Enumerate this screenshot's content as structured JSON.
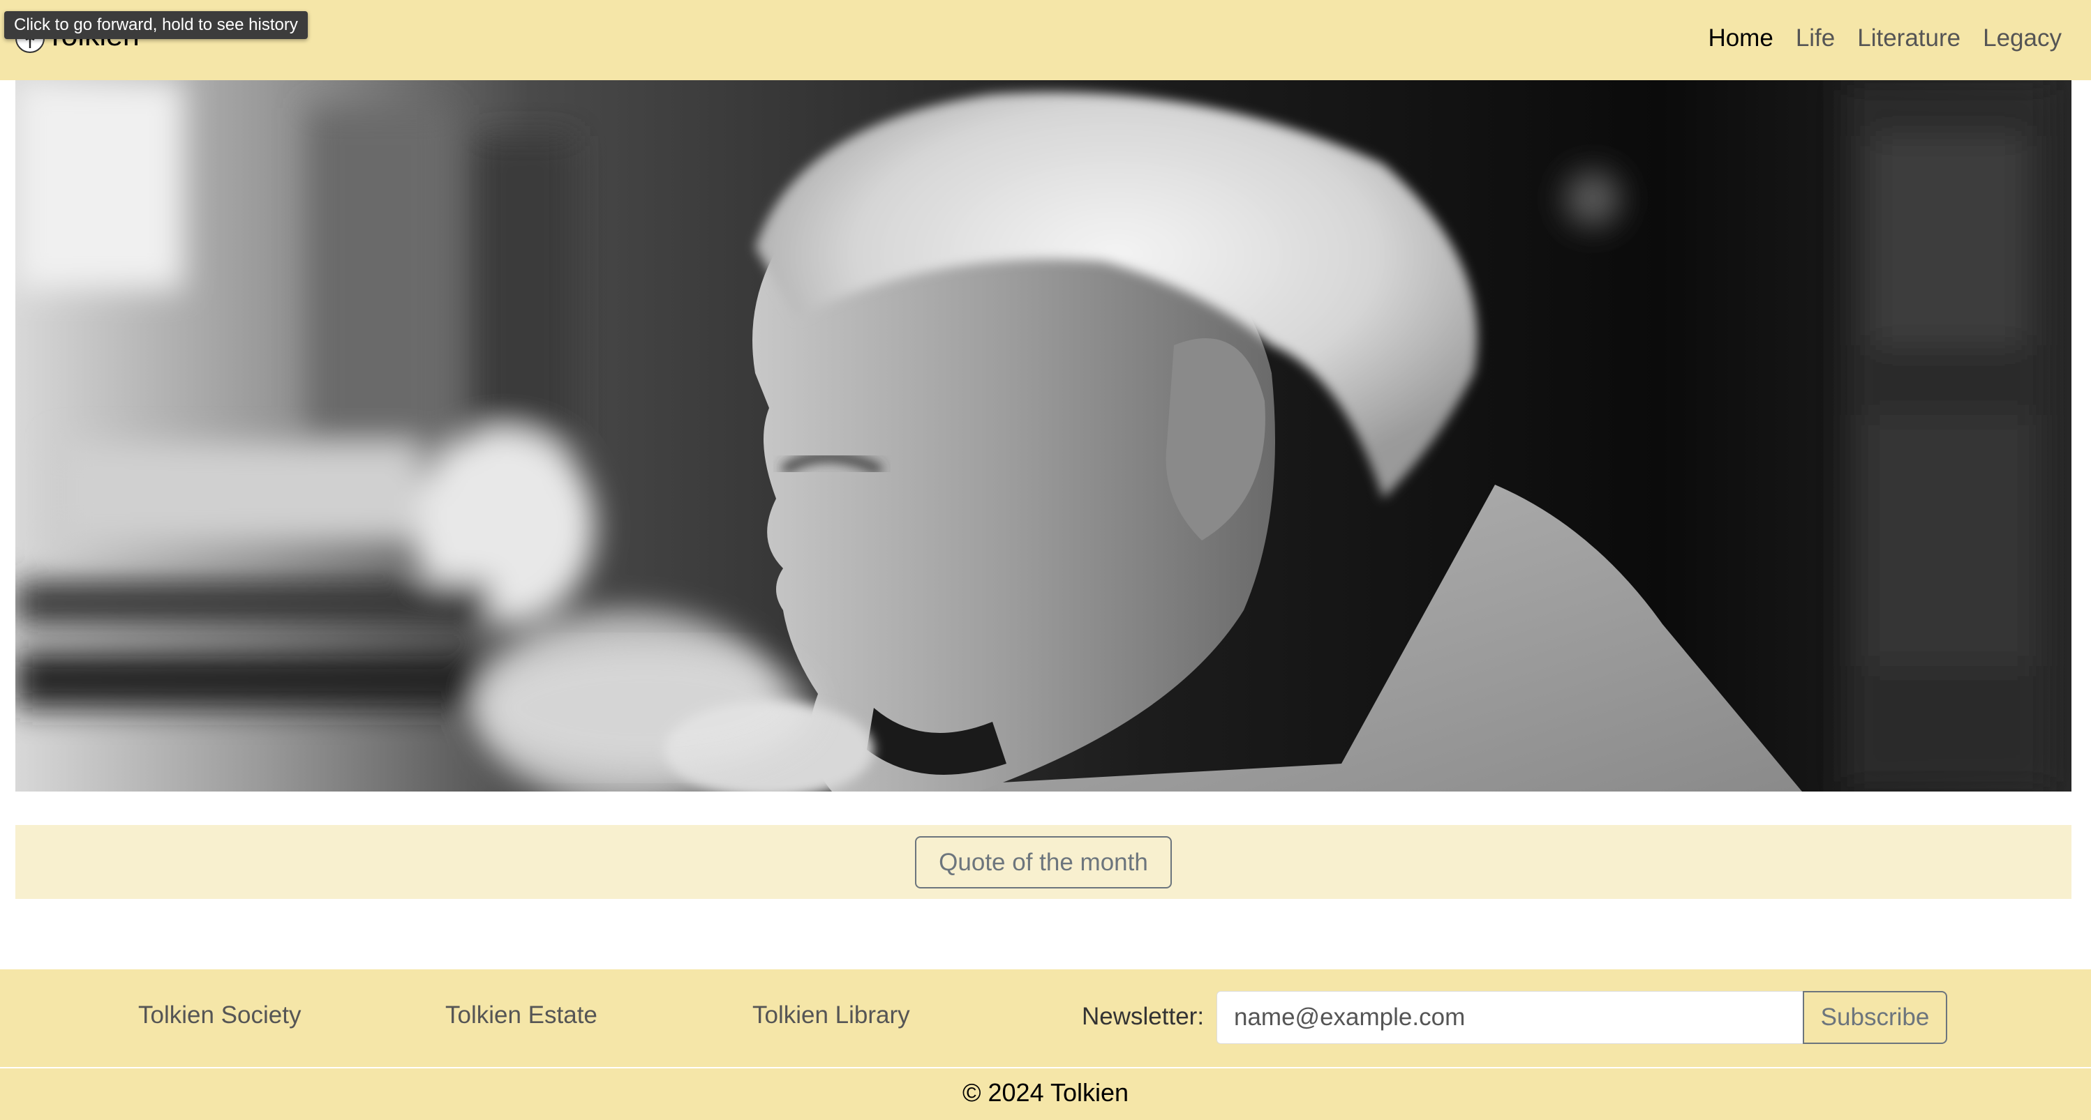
{
  "tooltip": "Click to go forward, hold to see history",
  "brand": {
    "name": "Tolkien",
    "logo_icon": "tolkien-monogram-icon"
  },
  "nav": {
    "items": [
      {
        "label": "Home",
        "active": true
      },
      {
        "label": "Life",
        "active": false
      },
      {
        "label": "Literature",
        "active": false
      },
      {
        "label": "Legacy",
        "active": false
      }
    ]
  },
  "hero": {
    "image": "black-and-white-portrait-of-tolkien"
  },
  "quote": {
    "button_label": "Quote of the month"
  },
  "footer": {
    "links": [
      "Tolkien Society",
      "Tolkien Estate",
      "Tolkien Library"
    ],
    "newsletter": {
      "label": "Newsletter:",
      "placeholder": "name@example.com",
      "button_label": "Subscribe"
    },
    "copyright": "© 2024 Tolkien"
  },
  "colors": {
    "header_bg": "#f5e6a8",
    "quote_band_bg": "#f8f0cf",
    "footer_bg": "#f5e6a8",
    "button_outline": "#6c757d"
  }
}
